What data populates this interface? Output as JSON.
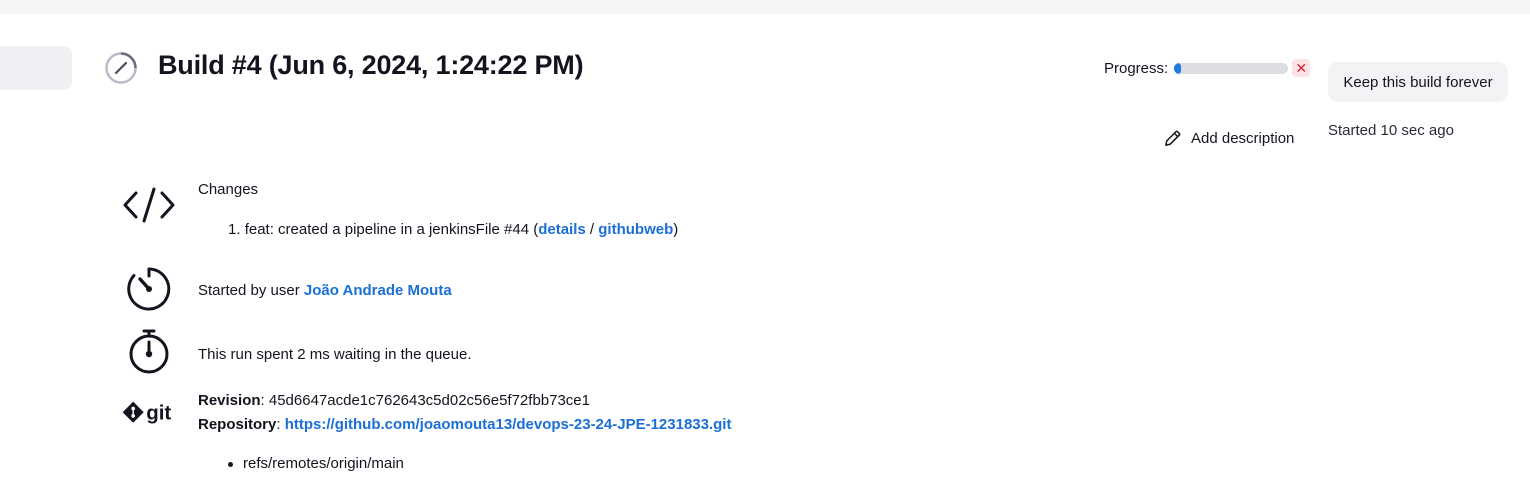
{
  "build": {
    "title": "Build #4 (Jun 6, 2024, 1:24:22 PM)",
    "progress_label": "Progress:",
    "progress_fraction": 0.06,
    "stop_symbol": "✕",
    "keep_label": "Keep this build forever",
    "add_description_label": "Add description",
    "started_ago": "Started 10 sec ago"
  },
  "changes": {
    "heading": "Changes",
    "items": [
      {
        "number": "1.",
        "text": "feat: created a pipeline in a jenkinsFile #44 (",
        "details_label": "details",
        "separator": " / ",
        "githubweb_label": "githubweb",
        "close": ")"
      }
    ]
  },
  "started_by": {
    "prefix": "Started by user ",
    "user": "João Andrade Mouta"
  },
  "queue": {
    "text": "This run spent 2 ms waiting in the queue."
  },
  "git": {
    "logo_text": "git",
    "revision_label": "Revision",
    "revision_value": ": 45d6647acde1c762643c5d02c56e5f72fbb73ce1",
    "repository_label": "Repository",
    "repository_sep": ": ",
    "repository_url": "https://github.com/joaomouta13/devops-23-24-JPE-1231833.git",
    "refs": [
      "refs/remotes/origin/main"
    ]
  },
  "colors": {
    "link": "#1a6fd8",
    "progress_fill": "#1d7ae0",
    "stop": "#d4213d"
  },
  "icons": {
    "status": "build-in-progress-icon",
    "changes": "code-icon",
    "started_by": "timer-icon",
    "queue": "stopwatch-icon",
    "git": "git-logo-icon",
    "edit": "pencil-icon"
  }
}
